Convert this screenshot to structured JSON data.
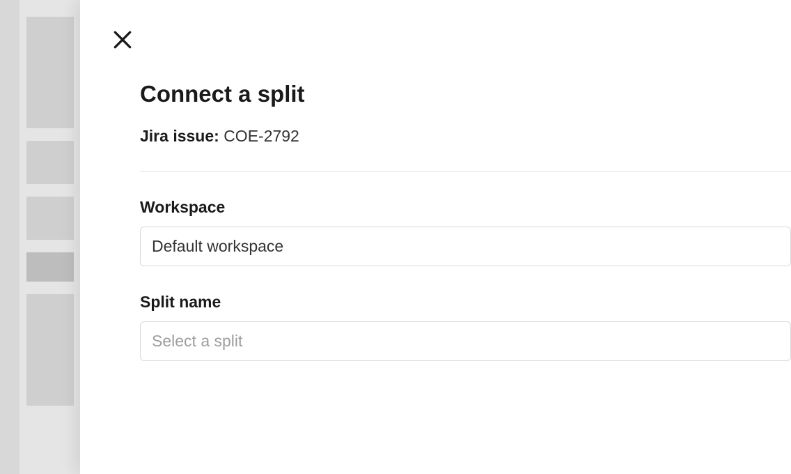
{
  "modal": {
    "title": "Connect a split",
    "issue_label": "Jira issue:",
    "issue_value": "COE-2792",
    "workspace": {
      "label": "Workspace",
      "value": "Default workspace"
    },
    "split_name": {
      "label": "Split name",
      "placeholder": "Select a split"
    }
  }
}
